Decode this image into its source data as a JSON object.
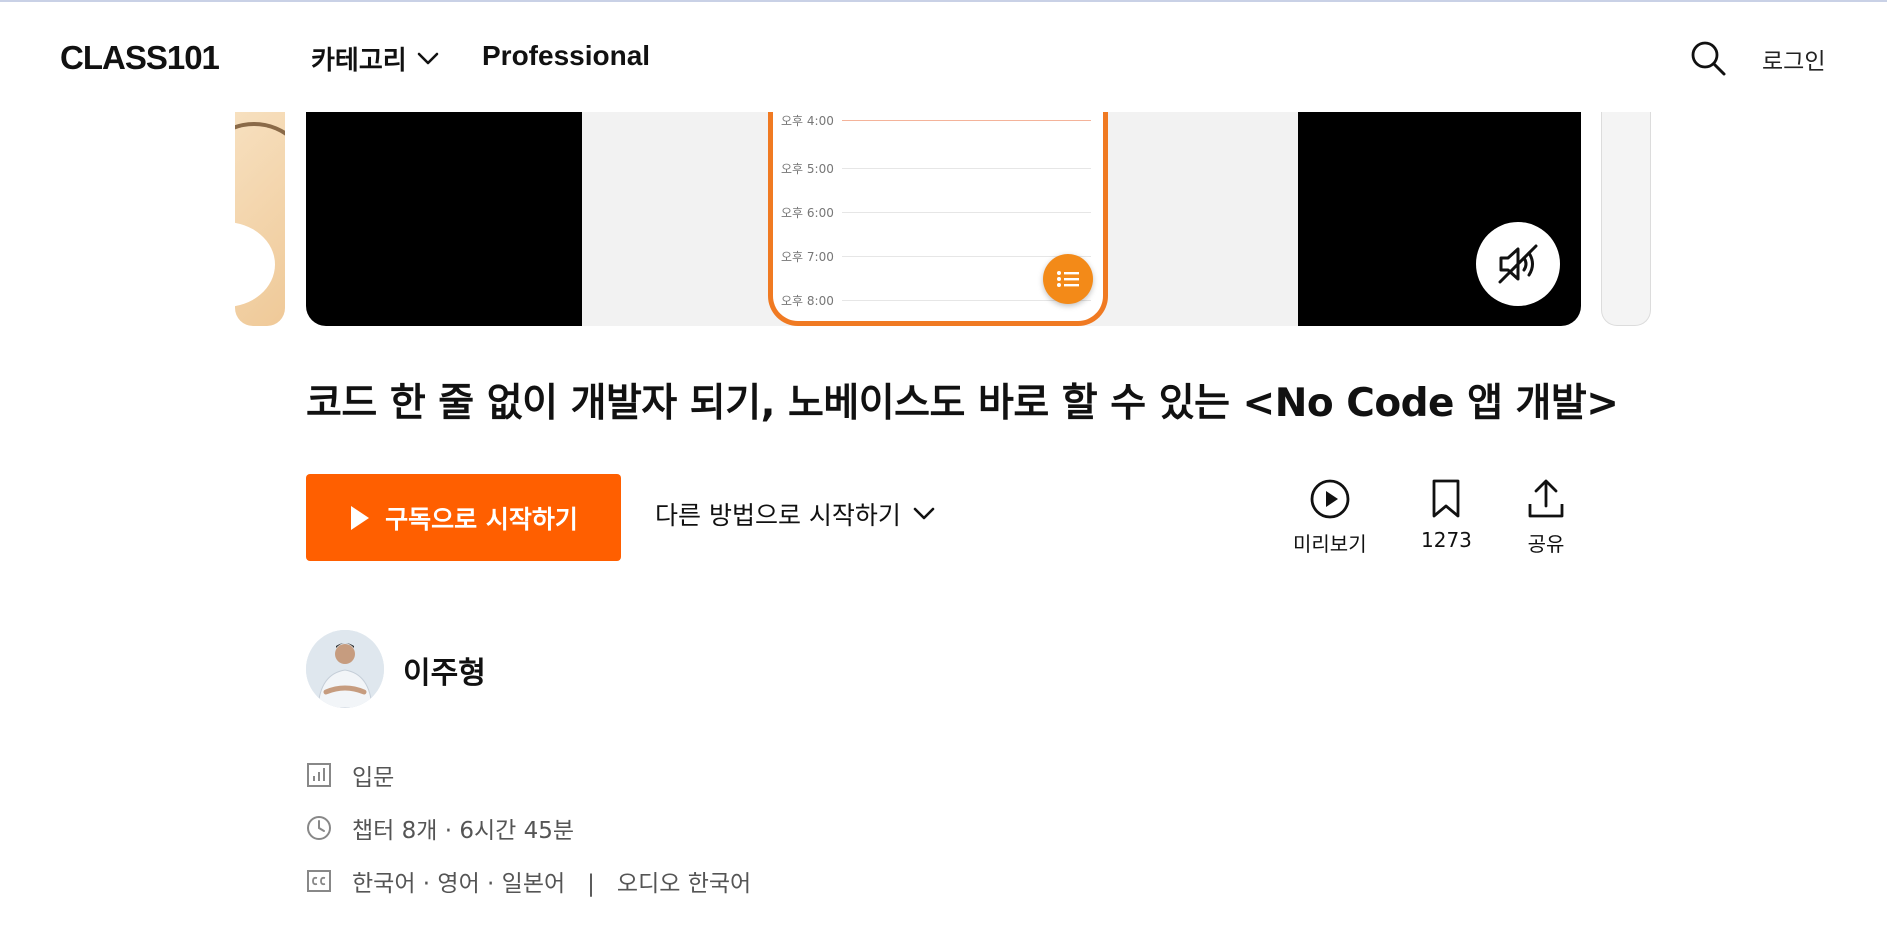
{
  "header": {
    "logo": "CLASS101",
    "nav_category": "카테고리",
    "nav_professional": "Professional",
    "login": "로그인"
  },
  "icons": {
    "search": "search-icon",
    "chevron": "chevron-down-icon",
    "mute": "speaker-muted-icon",
    "play": "play-icon",
    "preview": "play-circle-icon",
    "bookmark": "bookmark-icon",
    "share": "share-upload-icon",
    "level": "bar-chart-icon",
    "clock": "clock-icon",
    "caption": "closed-caption-icon"
  },
  "video": {
    "times": [
      "오후 4:00",
      "오후 5:00",
      "오후 6:00",
      "오후 7:00",
      "오후 8:00"
    ]
  },
  "course": {
    "title": "코드 한 줄 없이 개발자 되기, 노베이스도 바로 할 수 있는 <No Code 앱 개발>",
    "start_label": "구독으로 시작하기",
    "other_label": "다른 방법으로 시작하기",
    "actions": {
      "preview": "미리보기",
      "bookmark_count": "1273",
      "share": "공유"
    },
    "instructor": "이주형",
    "level": "입문",
    "duration": "챕터 8개 · 6시간 45분",
    "subtitles": "한국어 · 영어 · 일본어",
    "divider": "|",
    "audio": "오디오 한국어"
  },
  "colors": {
    "accent": "#ff5f00",
    "text": "#111111",
    "muted": "#555555"
  }
}
